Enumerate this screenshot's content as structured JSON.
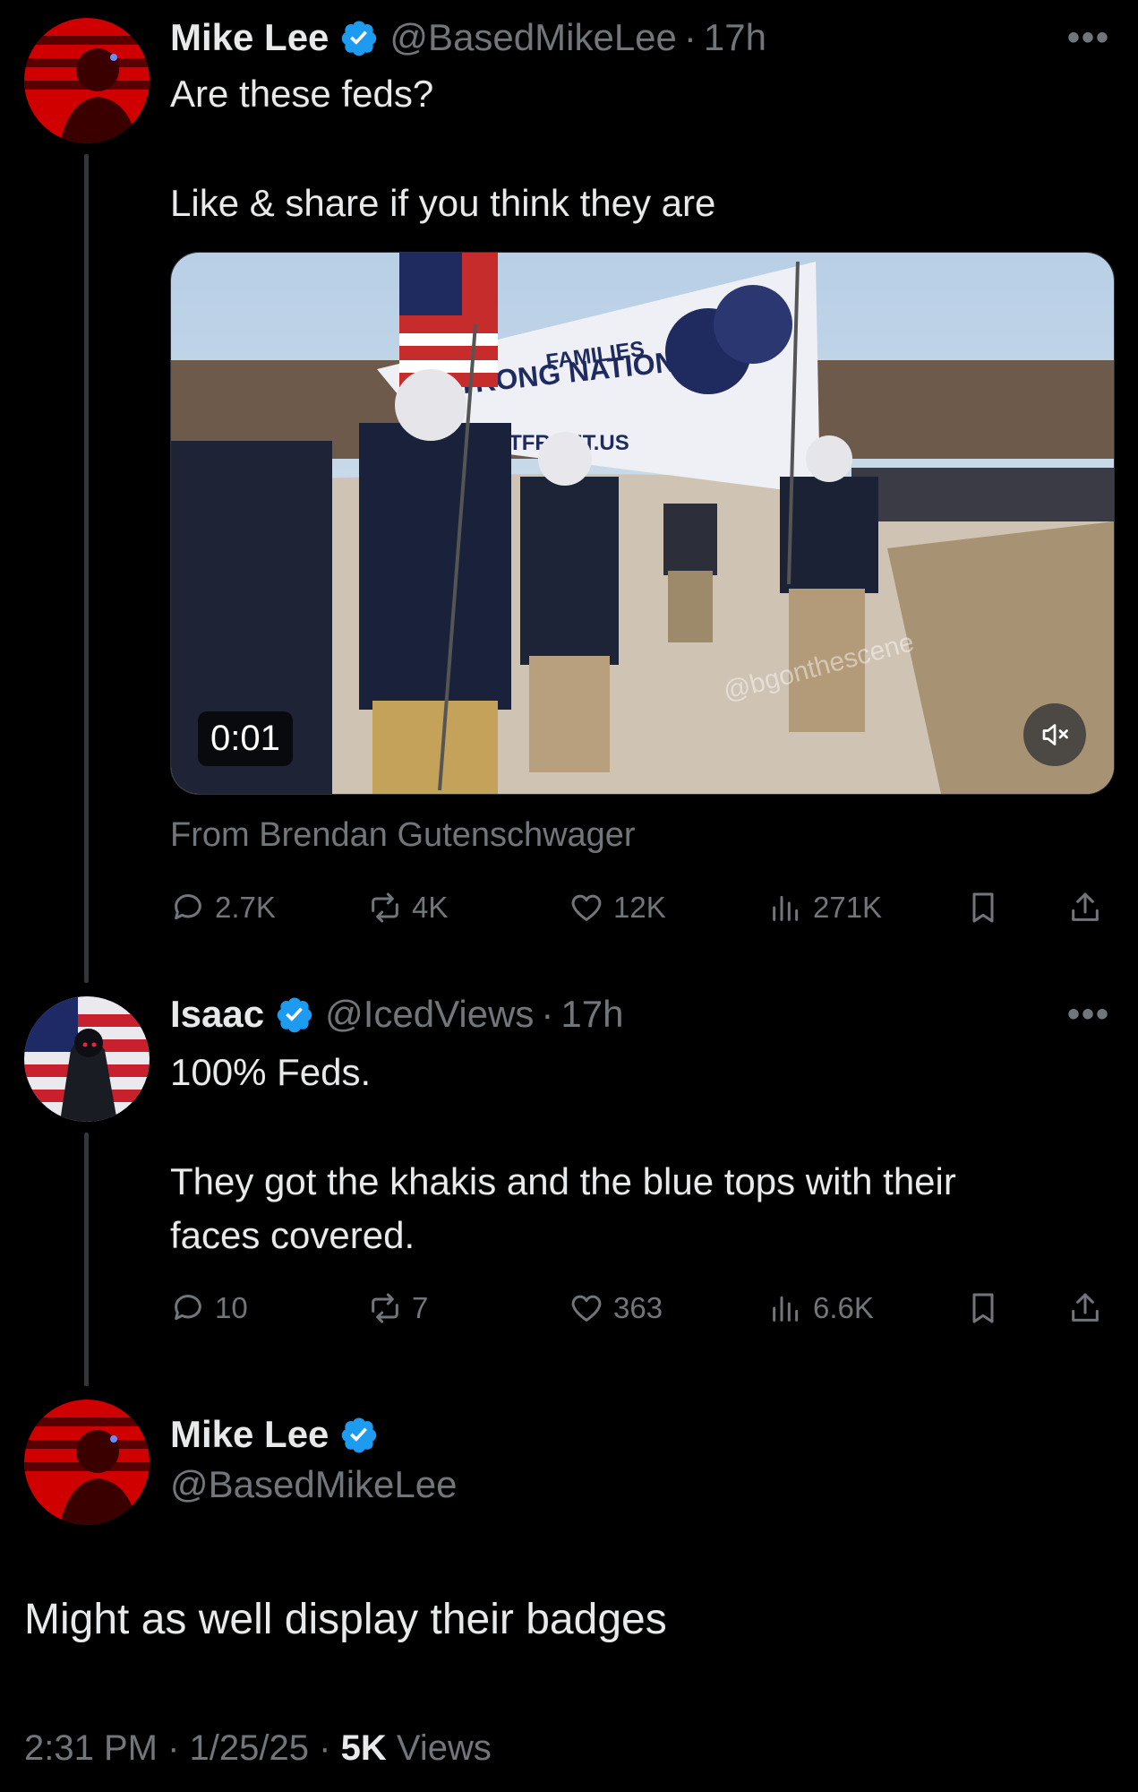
{
  "colors": {
    "background": "#000000",
    "text": "#e7e9ea",
    "muted": "#71767b",
    "verified": "#1d9bf0"
  },
  "tweet1": {
    "name": "Mike Lee",
    "handle": "@BasedMikeLee",
    "sep": "·",
    "time": "17h",
    "more": "•••",
    "line1": "Are these feds?",
    "line2": "Like & share if you think they are",
    "media": {
      "duration": "0:01",
      "banner_text_1": "FAMILIES",
      "banner_text_2": "STRONG NATIONS",
      "banner_text_3": "PATRIOTFRONT.US",
      "watermark": "@bgonthescene",
      "mute_icon": "speaker-muted-icon"
    },
    "from": "From Brendan Gutenschwager",
    "stats": {
      "replies": "2.7K",
      "reposts": "4K",
      "likes": "12K",
      "views": "271K"
    }
  },
  "tweet2": {
    "name": "Isaac",
    "handle": "@IcedViews",
    "sep": "·",
    "time": "17h",
    "more": "•••",
    "line1": "100% Feds.",
    "line2": "They got the khakis and the blue tops with their",
    "line3": "faces covered.",
    "stats": {
      "replies": "10",
      "reposts": "7",
      "likes": "363",
      "views": "6.6K"
    }
  },
  "tweet3": {
    "name": "Mike Lee",
    "handle": "@BasedMikeLee",
    "text": "Might as well display their badges",
    "time": "2:31 PM",
    "sep": "·",
    "date": "1/25/25",
    "views_count": "5K",
    "views_label": "Views"
  }
}
